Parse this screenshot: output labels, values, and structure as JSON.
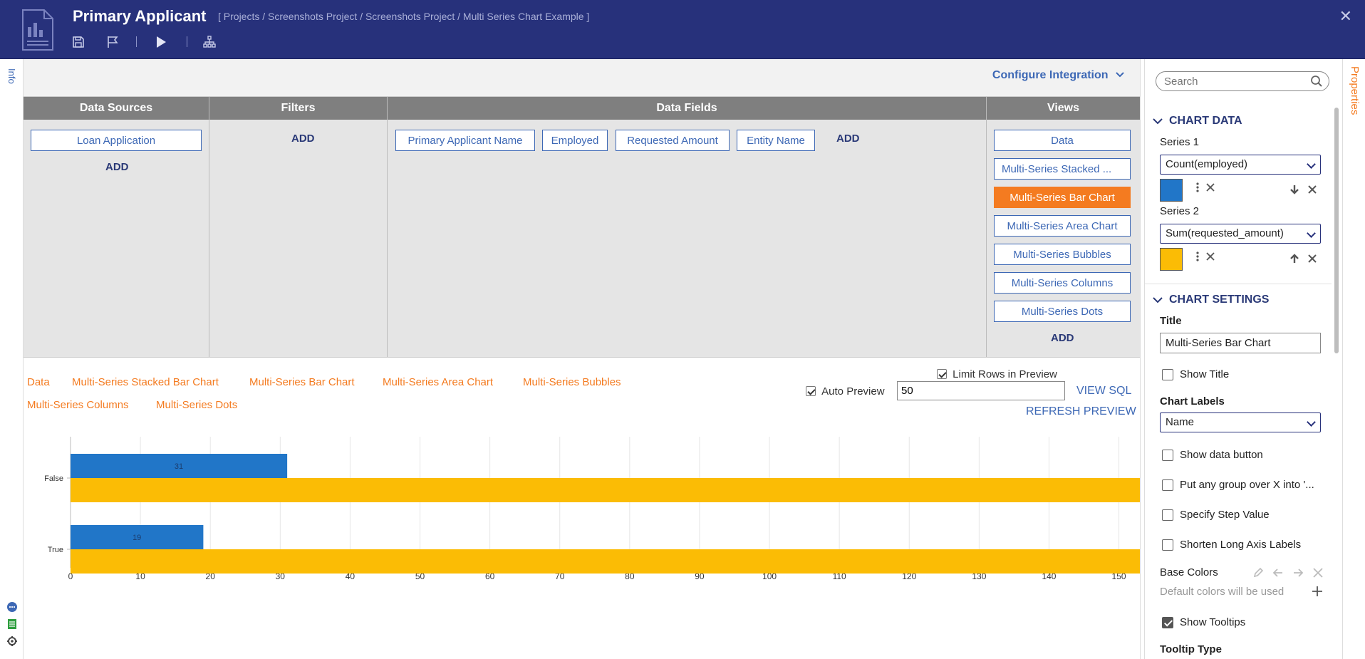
{
  "header": {
    "title": "Primary Applicant",
    "breadcrumb": "[ Projects / Screenshots Project / Screenshots Project / Multi Series Chart Example ]",
    "close": "✕"
  },
  "left_rail": {
    "info_tab": "Info"
  },
  "configure_integration": "Configure Integration",
  "columns": {
    "data_sources": {
      "header": "Data Sources",
      "items": [
        "Loan Application"
      ],
      "add": "ADD"
    },
    "filters": {
      "header": "Filters",
      "add": "ADD"
    },
    "data_fields": {
      "header": "Data Fields",
      "items": [
        "Primary Applicant Name",
        "Employed",
        "Requested Amount",
        "Entity Name"
      ],
      "add": "ADD"
    },
    "views": {
      "header": "Views",
      "items": [
        "Data",
        "Multi-Series Stacked ...",
        "Multi-Series Bar Chart",
        "Multi-Series Area Chart",
        "Multi-Series Bubbles",
        "Multi-Series Columns",
        "Multi-Series Dots"
      ],
      "active": "Multi-Series Bar Chart",
      "add": "ADD"
    }
  },
  "preview": {
    "view_links": [
      "Data",
      "Multi-Series Stacked Bar Chart",
      "Multi-Series Bar Chart",
      "Multi-Series Area Chart",
      "Multi-Series Bubbles",
      "Multi-Series Columns",
      "Multi-Series Dots"
    ],
    "limit_rows_label": "Limit Rows in Preview",
    "limit_rows_checked": true,
    "auto_preview_label": "Auto Preview",
    "auto_preview_checked": true,
    "rows_value": "50",
    "view_sql": "VIEW SQL",
    "refresh_preview": "REFRESH PREVIEW"
  },
  "chart_data": {
    "type": "bar",
    "orientation": "horizontal",
    "categories": [
      "False",
      "True"
    ],
    "series": [
      {
        "values": [
          31,
          19
        ],
        "color": "#2176c8",
        "data_labels": [
          "31",
          "19"
        ]
      },
      {
        "values": [
          153,
          153
        ],
        "color": "#fbbc05"
      }
    ],
    "xticks": [
      "0",
      "10",
      "20",
      "30",
      "40",
      "50",
      "60",
      "70",
      "80",
      "90",
      "100",
      "110",
      "120",
      "130",
      "140",
      "150"
    ],
    "xlim": [
      0,
      153
    ],
    "grid": true
  },
  "properties": {
    "tab_label": "Properties",
    "search_placeholder": "Search",
    "chart_data_header": "CHART DATA",
    "series": [
      {
        "label": "Series 1",
        "value": "Count(employed)",
        "color": "#2176c8"
      },
      {
        "label": "Series 2",
        "value": "Sum(requested_amount)",
        "color": "#fbbc05"
      }
    ],
    "chart_settings_header": "CHART SETTINGS",
    "title_label": "Title",
    "title_value": "Multi-Series Bar Chart",
    "show_title": {
      "label": "Show Title",
      "checked": false
    },
    "chart_labels_label": "Chart Labels",
    "chart_labels_value": "Name",
    "show_data_button": {
      "label": "Show data button",
      "checked": false
    },
    "group_over": {
      "label": "Put any group over X into '...",
      "checked": false
    },
    "step_value": {
      "label": "Specify Step Value",
      "checked": false
    },
    "shorten_labels": {
      "label": "Shorten Long Axis Labels",
      "checked": false
    },
    "base_colors_label": "Base Colors",
    "base_colors_hint": "Default colors will be used",
    "show_tooltips": {
      "label": "Show Tooltips",
      "checked": true
    },
    "tooltip_type_label": "Tooltip Type"
  },
  "colors": {
    "brand": "#27317b",
    "accent": "#f47b20",
    "link": "#3d68b5"
  }
}
